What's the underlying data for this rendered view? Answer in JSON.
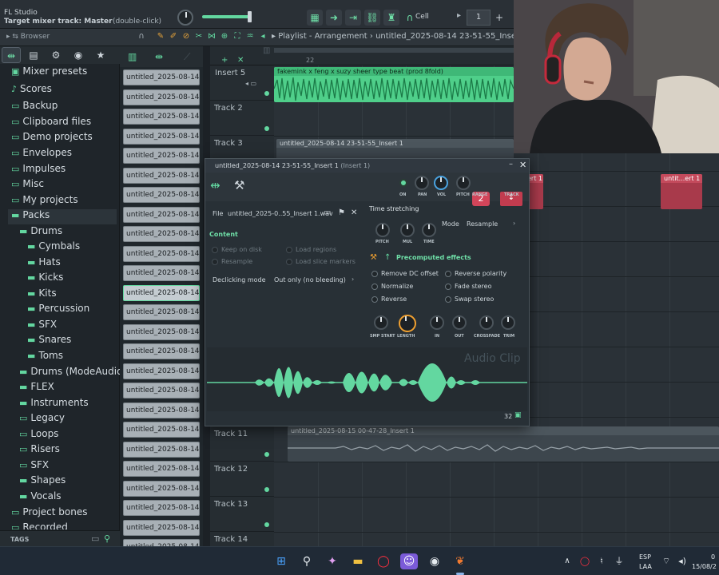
{
  "app": {
    "title": "FL Studio",
    "mixer_target": "Target mixer track: Master",
    "double_click_hint": "(double-click)"
  },
  "toolbar": {
    "snap_label": "Cell",
    "pattern_number": "1"
  },
  "playlist": {
    "title": "Playlist - Arrangement",
    "project_name": "untitled_2025-08-14 23-51-55_Insert 1",
    "ruler_bar": "22"
  },
  "browser": {
    "label": "Browser",
    "tags_label": "TAGS",
    "items": [
      {
        "label": "Mixer presets"
      },
      {
        "label": "Scores"
      },
      {
        "label": "Backup"
      },
      {
        "label": "Clipboard files"
      },
      {
        "label": "Demo projects"
      },
      {
        "label": "Envelopes"
      },
      {
        "label": "Impulses"
      },
      {
        "label": "Misc"
      },
      {
        "label": "My projects"
      },
      {
        "label": "Packs"
      },
      {
        "label": "Drums"
      },
      {
        "label": "Cymbals"
      },
      {
        "label": "Hats"
      },
      {
        "label": "Kicks"
      },
      {
        "label": "Kits"
      },
      {
        "label": "Percussion"
      },
      {
        "label": "SFX"
      },
      {
        "label": "Snares"
      },
      {
        "label": "Toms"
      },
      {
        "label": "Drums (ModeAudio)"
      },
      {
        "label": "FLEX"
      },
      {
        "label": "Instruments"
      },
      {
        "label": "Legacy"
      },
      {
        "label": "Loops"
      },
      {
        "label": "Risers"
      },
      {
        "label": "SFX"
      },
      {
        "label": "Shapes"
      },
      {
        "label": "Vocals"
      },
      {
        "label": "Project bones"
      },
      {
        "label": "Recorded"
      }
    ]
  },
  "clip_list": {
    "item_label": "untitled_2025-08-14 23-..."
  },
  "tracks": [
    {
      "name": "Insert 5"
    },
    {
      "name": "Track 2"
    },
    {
      "name": "Track 3"
    },
    {
      "name": "Track 11"
    },
    {
      "name": "Track 12"
    },
    {
      "name": "Track 13"
    },
    {
      "name": "Track 14"
    }
  ],
  "playlist_clips": {
    "beat": "fakemink x feng x suzy sheer type beat (prod 8fold)",
    "track3": "untitled_2025-08-14 23-51-55_Insert 1",
    "track11": "untitled_2025-08-15 00-47-28_Insert 1",
    "red1": "untit...ert 1",
    "red2": "ert 1"
  },
  "channel_settings": {
    "title": "untitled_2025-08-14 23-51-55_Insert 1",
    "subtitle": "(Insert 1)",
    "knob_labels": {
      "on": "ON",
      "pan": "PAN",
      "vol": "VOL",
      "pitch": "PITCH",
      "range": "RANGE",
      "track": "TRACK"
    },
    "range_value": "2",
    "file_label": "File",
    "file_name": "untitled_2025-0..55_Insert 1.wav",
    "time_stretching": "Time stretching",
    "ts_knobs": {
      "pitch": "PITCH",
      "mul": "MUL",
      "time": "TIME"
    },
    "mode_label": "Mode",
    "mode_value": "Resample",
    "content_label": "Content",
    "keep_on_disk": "Keep on disk",
    "load_regions": "Load regions",
    "resample": "Resample",
    "load_slice_markers": "Load slice markers",
    "precomputed_effects": "Precomputed effects",
    "effects": {
      "remove_dc": "Remove DC offset",
      "reverse_polarity": "Reverse polarity",
      "normalize": "Normalize",
      "fade_stereo": "Fade stereo",
      "reverse": "Reverse",
      "swap_stereo": "Swap stereo"
    },
    "declicking_label": "Declicking mode",
    "declicking_value": "Out only (no bleeding)",
    "bottom_knobs": {
      "smp_start": "SMP START",
      "length": "LENGTH",
      "in": "IN",
      "out": "OUT",
      "crossfade": "CROSSFADE",
      "trim": "TRIM"
    },
    "watermark": "Audio Clip",
    "footer_value": "32"
  },
  "taskbar": {
    "lang": "ESP",
    "region": "LAA",
    "date": "15/08/2",
    "time": "0"
  },
  "colors": {
    "accent": "#63d7a0",
    "clip_red": "#c23c4f",
    "bg": "#1c2126"
  }
}
